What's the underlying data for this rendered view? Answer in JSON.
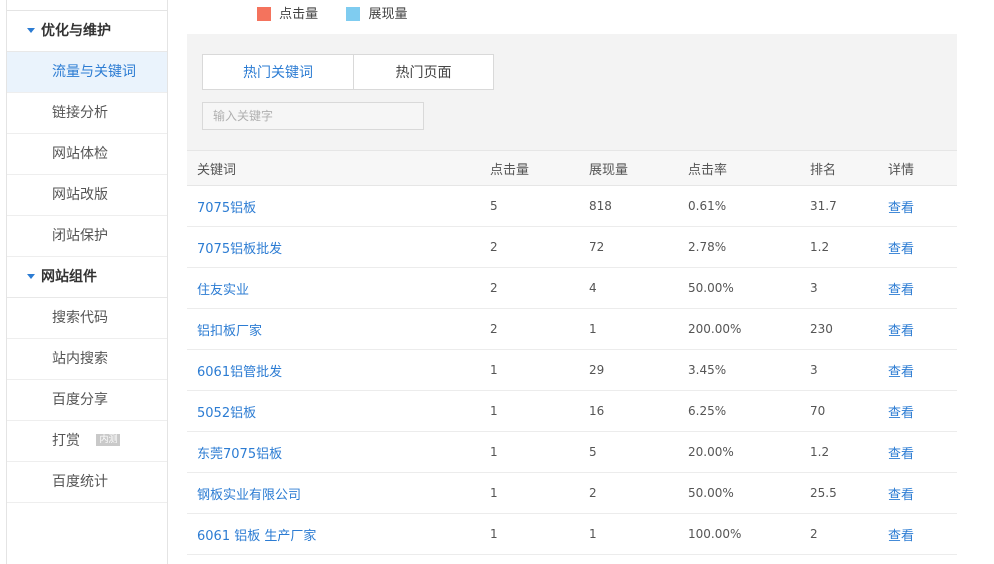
{
  "sidebar": {
    "sections": [
      {
        "title": "优化与维护",
        "items": [
          "流量与关键词",
          "链接分析",
          "网站体检",
          "网站改版",
          "闭站保护"
        ]
      },
      {
        "title": "网站组件",
        "items": [
          "搜索代码",
          "站内搜索",
          "百度分享",
          "打赏",
          "百度统计"
        ]
      }
    ],
    "badge": "内测"
  },
  "legend": {
    "clicks_label": "点击量",
    "clicks_color": "#f4735d",
    "impressions_label": "展现量",
    "impressions_color": "#7fccf0"
  },
  "tabs": [
    "热门关键词",
    "热门页面"
  ],
  "search": {
    "placeholder": "输入关键字"
  },
  "table": {
    "headers": [
      "关键词",
      "点击量",
      "展现量",
      "点击率",
      "排名",
      "详情"
    ],
    "rows": [
      {
        "keyword": "7075铝板",
        "clicks": "5",
        "impressions": "818",
        "ctr": "0.61%",
        "rank": "31.7",
        "detail": "查看"
      },
      {
        "keyword": "7075铝板批发",
        "clicks": "2",
        "impressions": "72",
        "ctr": "2.78%",
        "rank": "1.2",
        "detail": "查看"
      },
      {
        "keyword": "住友实业",
        "clicks": "2",
        "impressions": "4",
        "ctr": "50.00%",
        "rank": "3",
        "detail": "查看"
      },
      {
        "keyword": "铝扣板厂家",
        "clicks": "2",
        "impressions": "1",
        "ctr": "200.00%",
        "rank": "230",
        "detail": "查看"
      },
      {
        "keyword": "6061铝管批发",
        "clicks": "1",
        "impressions": "29",
        "ctr": "3.45%",
        "rank": "3",
        "detail": "查看"
      },
      {
        "keyword": "5052铝板",
        "clicks": "1",
        "impressions": "16",
        "ctr": "6.25%",
        "rank": "70",
        "detail": "查看"
      },
      {
        "keyword": "东莞7075铝板",
        "clicks": "1",
        "impressions": "5",
        "ctr": "20.00%",
        "rank": "1.2",
        "detail": "查看"
      },
      {
        "keyword": "钢板实业有限公司",
        "clicks": "1",
        "impressions": "2",
        "ctr": "50.00%",
        "rank": "25.5",
        "detail": "查看"
      },
      {
        "keyword": "6061 铝板 生产厂家",
        "clicks": "1",
        "impressions": "1",
        "ctr": "100.00%",
        "rank": "2",
        "detail": "查看"
      }
    ]
  }
}
